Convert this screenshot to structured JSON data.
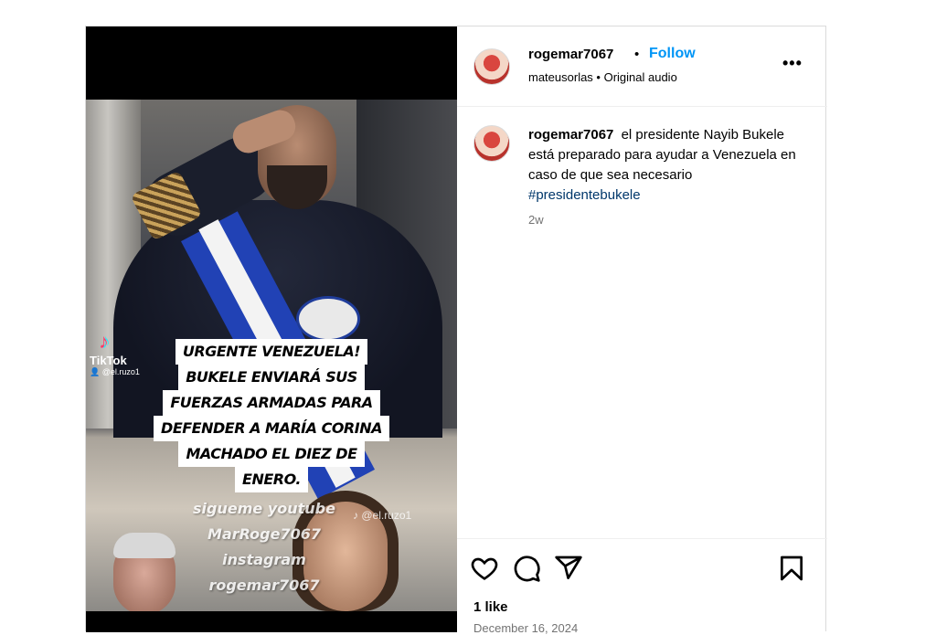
{
  "post": {
    "author": "rogemar7067",
    "follow_label": "Follow",
    "separator": "•",
    "audio_line": "mateusorlas • Original audio",
    "more_label": "•••",
    "caption_user": "rogemar7067",
    "caption_text": "el presidente Nayib Bukele está preparado para ayudar a Venezuela en caso de que sea necesario",
    "hashtag": "#presidentebukele",
    "time_ago": "2w",
    "likes": "1 like",
    "date": "December 16, 2024"
  },
  "video": {
    "tiktok_label": "TikTok",
    "tiktok_handle": "👤 @el.ruzo1",
    "caption_lines": [
      "URGENTE VENEZUELA!",
      "BUKELE ENVIARÁ SUS",
      "FUERZAS ARMADAS PARA",
      "DEFENDER A MARÍA CORINA",
      "MACHADO EL DIEZ DE",
      "ENERO."
    ],
    "overlay_lines": [
      "sigueme youtube",
      "MarRoge7067",
      "instagram",
      "rogemar7067"
    ],
    "watermark": "♪ @el.ruzo1"
  },
  "icons": {
    "like": "heart-icon",
    "comment": "comment-icon",
    "share": "share-icon",
    "save": "bookmark-icon",
    "more": "more-icon"
  },
  "colors": {
    "follow": "#0095f6",
    "hashtag": "#00376b",
    "muted": "#737373",
    "border": "#dbdbdb"
  }
}
